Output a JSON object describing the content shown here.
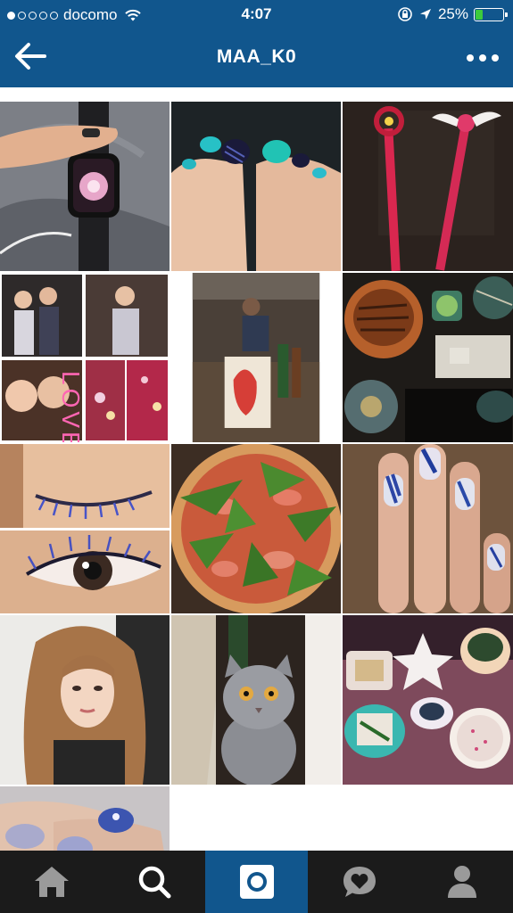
{
  "status_bar": {
    "carrier": "docomo",
    "time": "4:07",
    "battery": "25%",
    "battery_level": 0.25,
    "signal_bars": 1
  },
  "header": {
    "title": "MAA_K0",
    "back_icon": "arrow-left-icon",
    "more_icon": "more-dots-icon",
    "bg_color": "#11568d"
  },
  "grid": {
    "tiles": [
      {
        "name": "watch-photo"
      },
      {
        "name": "pedicure-photo"
      },
      {
        "name": "magic-wands-photo"
      },
      {
        "name": "love-collage-photo",
        "text": "LOVE"
      },
      {
        "name": "kitchen-photo"
      },
      {
        "name": "eel-meal-photo"
      },
      {
        "name": "eyelash-photo"
      },
      {
        "name": "pizza-photo"
      },
      {
        "name": "nail-art-photo"
      },
      {
        "name": "portrait-photo"
      },
      {
        "name": "cat-photo"
      },
      {
        "name": "japanese-dishes-photo"
      },
      {
        "name": "nails-close-photo"
      }
    ]
  },
  "tab_bar": {
    "tabs": [
      {
        "name": "home",
        "icon": "home-icon"
      },
      {
        "name": "search",
        "icon": "search-icon"
      },
      {
        "name": "camera",
        "icon": "camera-icon",
        "active": true
      },
      {
        "name": "activity",
        "icon": "heart-bubble-icon"
      },
      {
        "name": "profile",
        "icon": "profile-icon"
      }
    ],
    "active_color": "#11568d"
  }
}
